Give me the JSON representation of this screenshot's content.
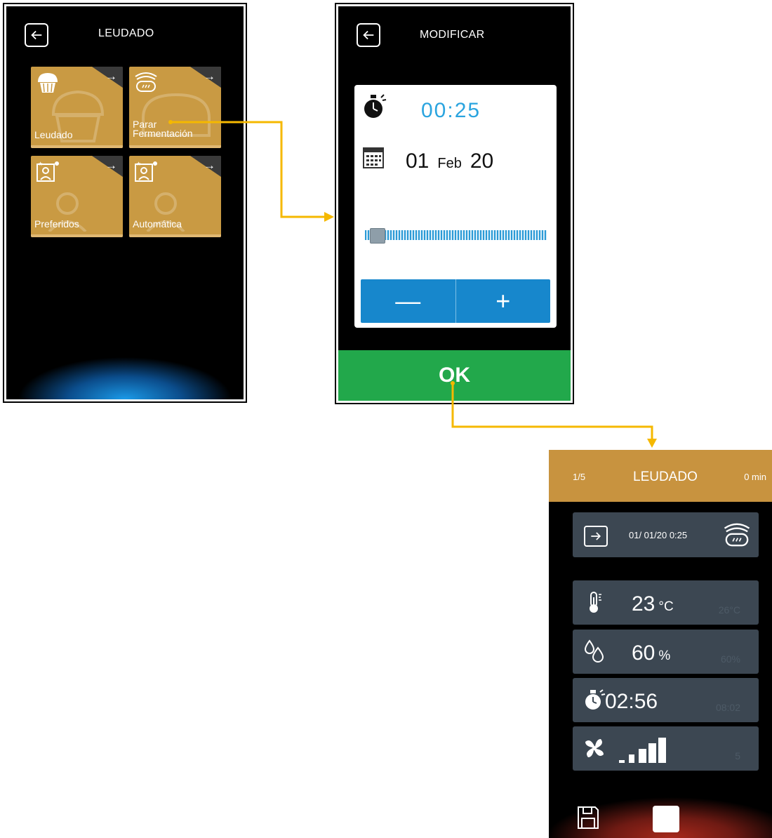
{
  "screen_leudado": {
    "title": "LEUDADO",
    "tiles": [
      {
        "label_line1": "Leudado",
        "label_line2": ""
      },
      {
        "label_line1": "Parar",
        "label_line2": "Fermentación"
      },
      {
        "label_line1": "Preferidos",
        "label_line2": ""
      },
      {
        "label_line1": "Automática",
        "label_line2": ""
      }
    ]
  },
  "screen_modificar": {
    "title": "MODIFICAR",
    "time": "00:25",
    "date_day": "01",
    "date_month": "Feb",
    "date_year": "20",
    "slider_level": 0.03,
    "minus_label": "—",
    "plus_label": "+",
    "ok_label": "OK"
  },
  "screen_running": {
    "step": "1/5",
    "title": "LEUDADO",
    "elapsed": "0 min",
    "program_text": "01/ 01/20  0:25",
    "temperature": {
      "value": "23",
      "unit": "°C",
      "setpoint": "26°C"
    },
    "humidity": {
      "value": "60",
      "unit": "%",
      "setpoint": "60%"
    },
    "timer": {
      "value": "02:56",
      "setpoint": "08:02"
    },
    "fan": {
      "level": 5,
      "max": 5,
      "setpoint": "5"
    }
  },
  "colors": {
    "tile": "#c99a43",
    "accent_blue": "#2aa4df",
    "ok_green": "#22a84b",
    "header_gold": "#c8933f",
    "connector": "#f5b800"
  }
}
